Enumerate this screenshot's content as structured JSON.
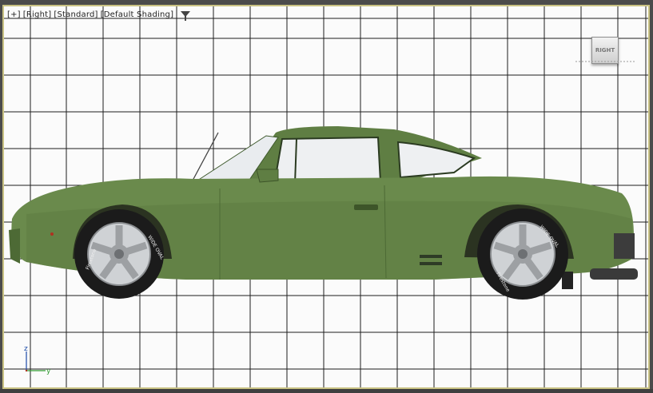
{
  "viewport": {
    "label_items": [
      "[+]",
      "[Right]",
      "[Standard]",
      "[Default Shading]"
    ],
    "viewcube_label": "RIGHT",
    "axis": {
      "z": "z",
      "y": "y"
    },
    "tire_text_1": "WIDE OVAL",
    "tire_text_2": "Firestone"
  },
  "colors": {
    "viewport_bg": "#fbfbfb",
    "grid_line": "#1e1e1e",
    "frame_border": "#c9c283",
    "car_body": "#6a8a4c",
    "axis_z": "#1a4aa8",
    "axis_y": "#2f9a2f"
  }
}
